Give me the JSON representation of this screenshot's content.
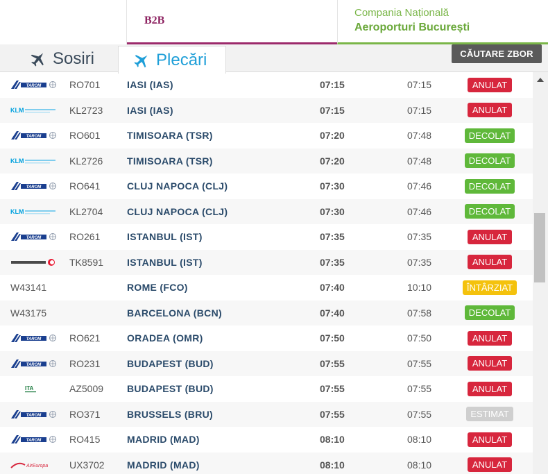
{
  "header": {
    "b2b_label": "B2B",
    "company_line1": "Compania Națională",
    "company_line2": "Aeroporturi București"
  },
  "tabs": {
    "arrivals_label": "Sosiri",
    "departures_label": "Plecări",
    "active": "departures"
  },
  "search_button_label": "CĂUTARE ZBOR",
  "status_colors": {
    "ANULAT": "#d7263d",
    "DECOLAT": "#5fb83a",
    "ÎNTÂRZIAT": "#f4c20d",
    "ESTIMAT": "#cfcfcf"
  },
  "flights": [
    {
      "airline": "tarom",
      "flight": "RO701",
      "destination": "IASI (IAS)",
      "scheduled": "07:15",
      "estimated": "07:15",
      "status": "ANULAT"
    },
    {
      "airline": "klm",
      "flight": "KL2723",
      "destination": "IASI (IAS)",
      "scheduled": "07:15",
      "estimated": "07:15",
      "status": "ANULAT"
    },
    {
      "airline": "tarom",
      "flight": "RO601",
      "destination": "TIMISOARA (TSR)",
      "scheduled": "07:20",
      "estimated": "07:48",
      "status": "DECOLAT"
    },
    {
      "airline": "klm",
      "flight": "KL2726",
      "destination": "TIMISOARA (TSR)",
      "scheduled": "07:20",
      "estimated": "07:48",
      "status": "DECOLAT"
    },
    {
      "airline": "tarom",
      "flight": "RO641",
      "destination": "CLUJ NAPOCA (CLJ)",
      "scheduled": "07:30",
      "estimated": "07:46",
      "status": "DECOLAT"
    },
    {
      "airline": "klm",
      "flight": "KL2704",
      "destination": "CLUJ NAPOCA (CLJ)",
      "scheduled": "07:30",
      "estimated": "07:46",
      "status": "DECOLAT"
    },
    {
      "airline": "tarom",
      "flight": "RO261",
      "destination": "ISTANBUL (IST)",
      "scheduled": "07:35",
      "estimated": "07:35",
      "status": "ANULAT"
    },
    {
      "airline": "turkish",
      "flight": "TK8591",
      "destination": "ISTANBUL (IST)",
      "scheduled": "07:35",
      "estimated": "07:35",
      "status": "ANULAT"
    },
    {
      "airline": "",
      "flight": "W43141",
      "destination": "ROME (FCO)",
      "scheduled": "07:40",
      "estimated": "10:10",
      "status": "ÎNTÂRZIAT"
    },
    {
      "airline": "",
      "flight": "W43175",
      "destination": "BARCELONA (BCN)",
      "scheduled": "07:40",
      "estimated": "07:58",
      "status": "DECOLAT"
    },
    {
      "airline": "tarom",
      "flight": "RO621",
      "destination": "ORADEA (OMR)",
      "scheduled": "07:50",
      "estimated": "07:50",
      "status": "ANULAT"
    },
    {
      "airline": "tarom",
      "flight": "RO231",
      "destination": "BUDAPEST (BUD)",
      "scheduled": "07:55",
      "estimated": "07:55",
      "status": "ANULAT"
    },
    {
      "airline": "ita",
      "flight": "AZ5009",
      "destination": "BUDAPEST (BUD)",
      "scheduled": "07:55",
      "estimated": "07:55",
      "status": "ANULAT"
    },
    {
      "airline": "tarom",
      "flight": "RO371",
      "destination": "BRUSSELS (BRU)",
      "scheduled": "07:55",
      "estimated": "07:55",
      "status": "ESTIMAT"
    },
    {
      "airline": "tarom",
      "flight": "RO415",
      "destination": "MADRID (MAD)",
      "scheduled": "08:10",
      "estimated": "08:10",
      "status": "ANULAT"
    },
    {
      "airline": "aireuropa",
      "flight": "UX3702",
      "destination": "MADRID (MAD)",
      "scheduled": "08:10",
      "estimated": "08:10",
      "status": "ANULAT"
    }
  ]
}
